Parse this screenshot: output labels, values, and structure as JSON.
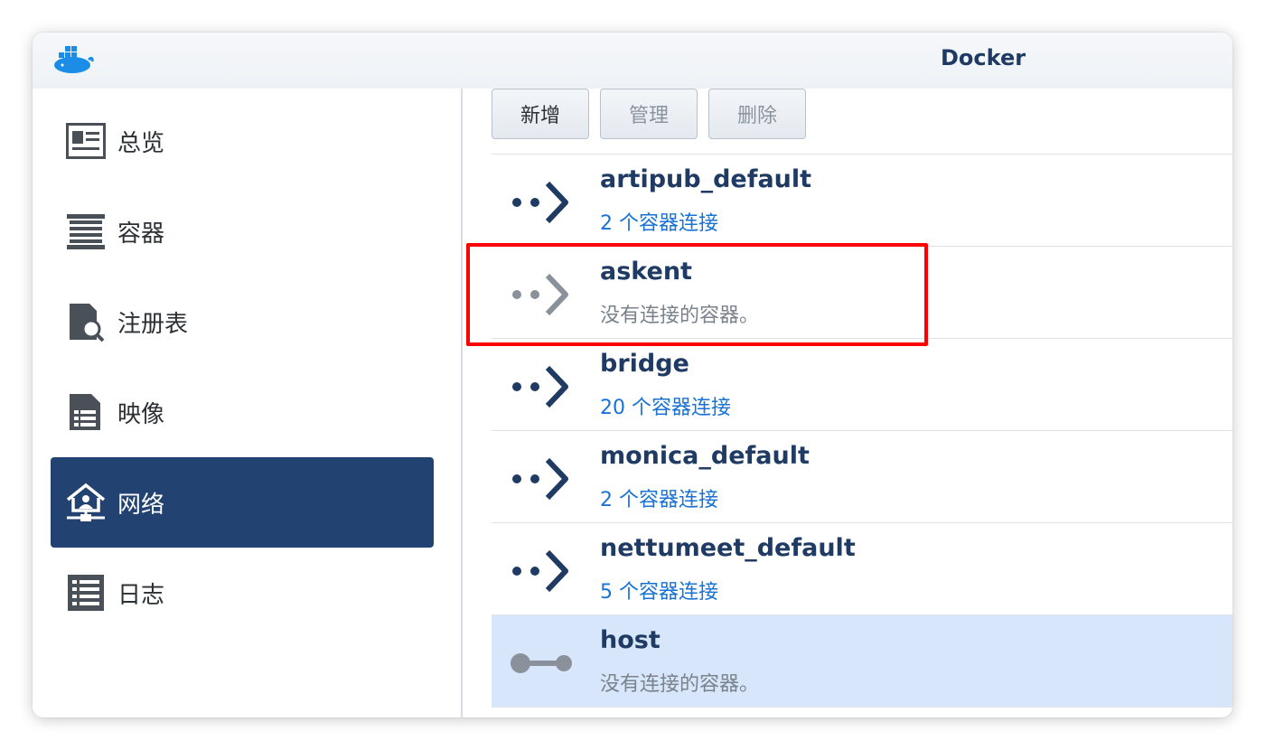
{
  "window": {
    "title": "Docker",
    "logo_icon": "docker-whale-icon"
  },
  "sidebar": {
    "items": [
      {
        "label": "总览",
        "icon": "overview-card-icon",
        "active": false
      },
      {
        "label": "容器",
        "icon": "container-list-icon",
        "active": false
      },
      {
        "label": "注册表",
        "icon": "registry-search-icon",
        "active": false
      },
      {
        "label": "映像",
        "icon": "image-document-icon",
        "active": false
      },
      {
        "label": "网络",
        "icon": "network-house-icon",
        "active": true
      },
      {
        "label": "日志",
        "icon": "log-list-icon",
        "active": false
      }
    ]
  },
  "toolbar": {
    "add_label": "新增",
    "manage_label": "管理",
    "delete_label": "删除"
  },
  "networks": [
    {
      "name": "artipub_default",
      "status": "2 个容器连接",
      "connected": true,
      "icon": "network-arrow-icon"
    },
    {
      "name": "askent",
      "status": "没有连接的容器。",
      "connected": false,
      "icon": "network-arrow-icon"
    },
    {
      "name": "bridge",
      "status": "20 个容器连接",
      "connected": true,
      "icon": "network-arrow-icon"
    },
    {
      "name": "monica_default",
      "status": "2 个容器连接",
      "connected": true,
      "icon": "network-arrow-icon"
    },
    {
      "name": "nettumeet_default",
      "status": "5 个容器连接",
      "connected": true,
      "icon": "network-arrow-icon"
    },
    {
      "name": "host",
      "status": "没有连接的容器。",
      "connected": false,
      "selected": true,
      "icon": "host-link-icon"
    }
  ],
  "colors": {
    "accent": "#224272",
    "link": "#1a73d4",
    "highlight": "#ff0000",
    "selected_row": "#d7e6fb"
  }
}
